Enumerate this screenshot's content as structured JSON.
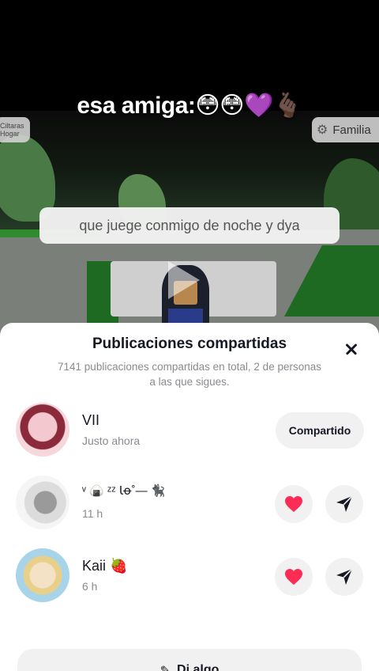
{
  "video": {
    "caption": "esa amiga:😳😳💜🫰🏿",
    "chat_bubble": "que juege conmigo de noche y dya",
    "left_chip_text": "Ciltaras Hogar",
    "right_chip_text": "Familia"
  },
  "sheet": {
    "title": "Publicaciones compartidas",
    "subtitle": "7141 publicaciones compartidas en total, 2 de personas a las que sigues.",
    "rows": [
      {
        "name": "VII",
        "time": "Justo ahora",
        "action_label": "Compartido"
      },
      {
        "name": "ᵛ 🍙 ᶻᶻ Ꙇꝋ˚— 🐈‍⬛",
        "time": "11 h"
      },
      {
        "name": "Kaii 🍓",
        "time": "6 h"
      }
    ],
    "comment_label": "Di algo"
  },
  "colors": {
    "heart": "#fe2c55",
    "text_primary": "#161823",
    "text_secondary": "#8a8b91",
    "button_bg": "#f1f1f2"
  }
}
